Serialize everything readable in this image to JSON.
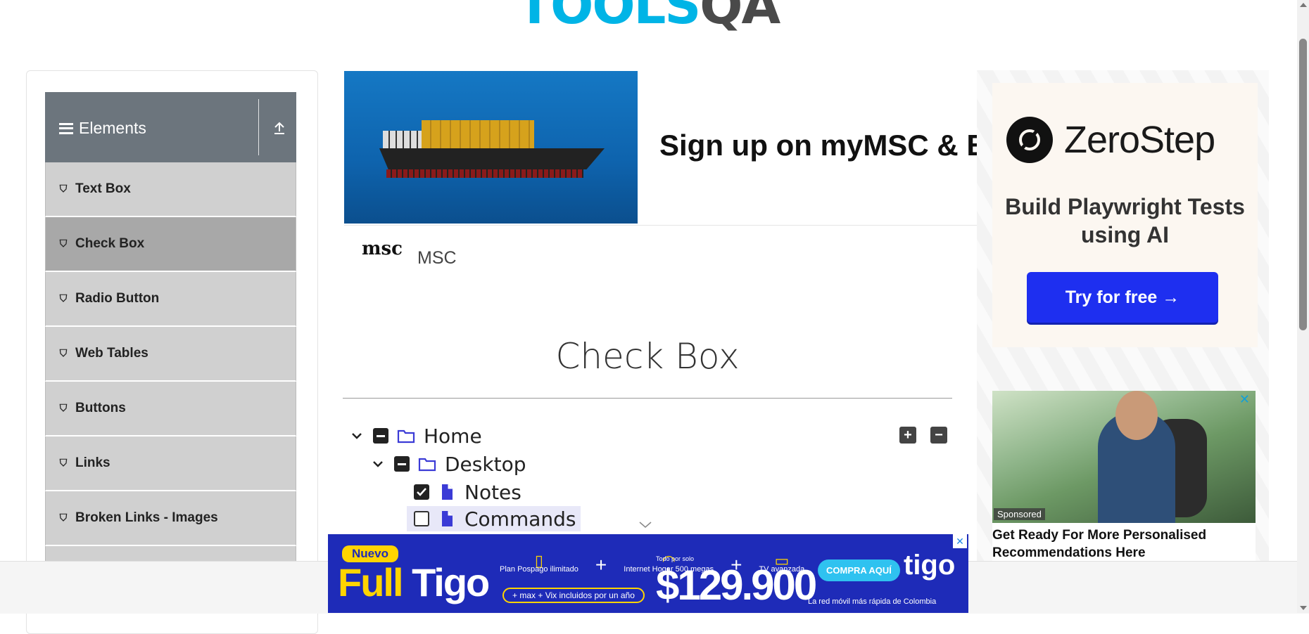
{
  "logo": {
    "part1": "TOOLS",
    "part2": "QA"
  },
  "sidebar": {
    "group_title": "Elements",
    "items": [
      {
        "label": "Text Box"
      },
      {
        "label": "Check Box"
      },
      {
        "label": "Radio Button"
      },
      {
        "label": "Web Tables"
      },
      {
        "label": "Buttons"
      },
      {
        "label": "Links"
      },
      {
        "label": "Broken Links - Images"
      }
    ]
  },
  "banner_ad": {
    "headline": "Sign up on myMSC & B",
    "advertiser": "MSC",
    "logo_text": "msc"
  },
  "main": {
    "title": "Check Box",
    "tree": [
      {
        "label": "Home",
        "state": "half"
      },
      {
        "label": "Desktop",
        "state": "half"
      },
      {
        "label": "Notes",
        "state": "checked"
      },
      {
        "label": "Commands",
        "state": "unchecked"
      }
    ],
    "expand_all": "+",
    "collapse_all": "−"
  },
  "right_ad": {
    "brand": "ZeroStep",
    "tagline": "Build Playwright Tests using AI",
    "cta": "Try for free →"
  },
  "right_ad2": {
    "badge": "Sponsored",
    "headline": "Get Ready For More Personalised Recommendations Here"
  },
  "bottom_ad": {
    "badge": "Nuevo",
    "brand_full": "Full",
    "brand_tigo": "Tigo",
    "item1": "Plan Pospago ilimitado",
    "item2": "Internet Hogar 500 megas",
    "item3": "TV avanzada",
    "pill_text": "+ max + Vix incluidos por un año",
    "small": "Todo por solo",
    "price": "$129.900",
    "cta": "COMPRA AQUÍ",
    "logo": "tigo",
    "tagline": "La red móvil más rápida de Colombia"
  },
  "colors": {
    "accent": "#00b4e6",
    "sidebar_header": "#6c757d",
    "cta_blue": "#1e2ff0",
    "tigo_blue": "#1e2bb8"
  }
}
